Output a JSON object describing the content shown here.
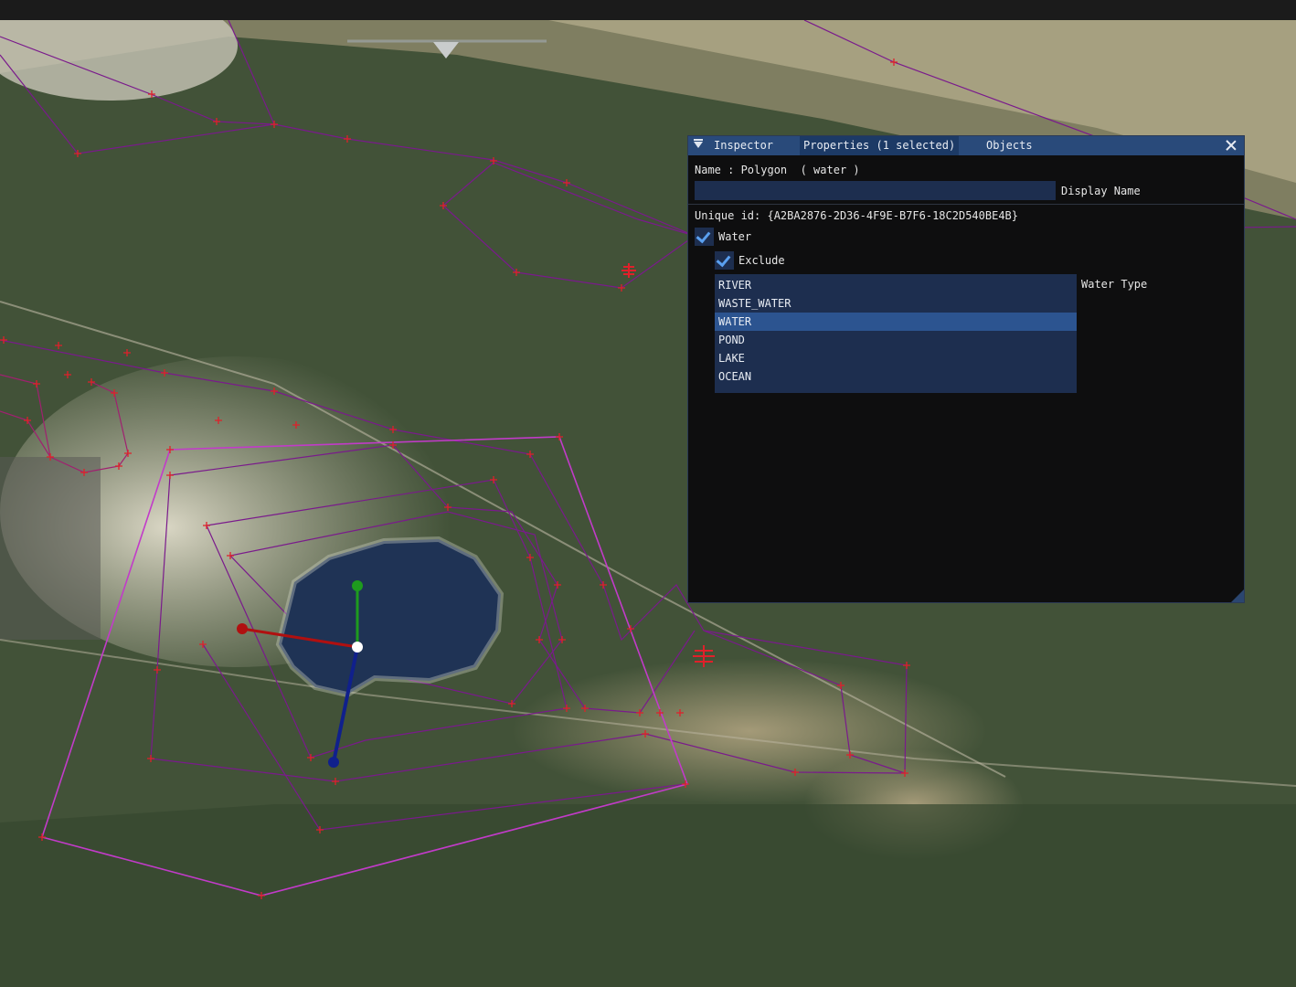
{
  "panel": {
    "tabs": [
      {
        "label": "Inspector"
      },
      {
        "label": "Properties (1 selected)"
      },
      {
        "label": "Objects"
      }
    ],
    "name_label": "Name : Polygon  ( water )",
    "display_name": {
      "value": "",
      "label": "Display Name"
    },
    "unique_id": "Unique id: {A2BA2876-2D36-4F9E-B7F6-18C2D540BE4B}",
    "water_checkbox": {
      "label": "Water",
      "checked": true
    },
    "exclude_checkbox": {
      "label": "Exclude",
      "checked": true
    },
    "water_type": {
      "label": "Water Type",
      "options": [
        "RIVER",
        "WASTE_WATER",
        "WATER",
        "POND",
        "LAKE",
        "OCEAN"
      ],
      "selected": "WATER"
    }
  },
  "colors": {
    "titlebar": "#294a7a",
    "tab_active": "#1c3a66",
    "input_bg": "#1d2e4f",
    "list_selected": "#2c5490",
    "panel_bg": "#0e0e0f",
    "polygon_magenta": "#c23bc9",
    "polygon_purple": "#7a1a8c",
    "vertex_red": "#e0202a",
    "water_body": "#1f3355",
    "gizmo_x": "#b01010",
    "gizmo_y": "#1e9b1e",
    "gizmo_z": "#10208c"
  },
  "icons": [
    "collapse-triangle-icon",
    "close-icon",
    "checkmark-icon",
    "resize-grip-icon"
  ]
}
